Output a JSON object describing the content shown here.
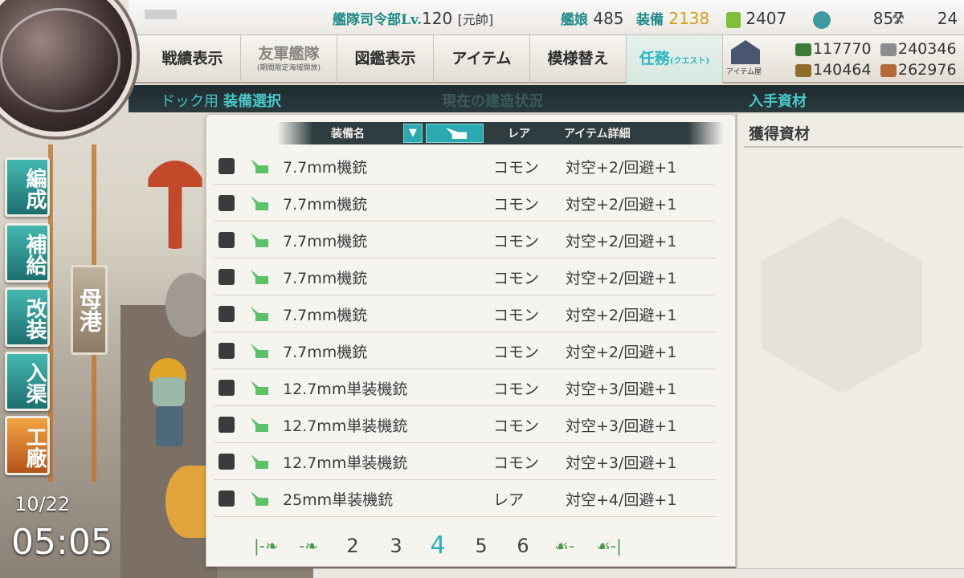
{
  "player": {
    "name_hidden": "",
    "hq_label": "艦隊司令部Lv.",
    "hq_level": "120",
    "rank": "[元帥]",
    "ships_label": "艦娘",
    "ships_count": "485",
    "equip_label": "装備",
    "equip_count": "2138"
  },
  "consumables": {
    "bucket": "2407",
    "devmat": "857",
    "screw": "24"
  },
  "resources": {
    "fuel": "117770",
    "steel": "240346",
    "ammo": "140464",
    "bauxite": "262976"
  },
  "menu": {
    "record": "戦績表示",
    "friend_fleet": "友軍艦隊",
    "friend_fleet_sub": "(期間限定海域開放)",
    "album": "図鑑表示",
    "items": "アイテム",
    "remodel": "模様替え",
    "quest": "任務",
    "quest_sub": "(クエスト)",
    "item_shop_label": "アイテム屋"
  },
  "section": {
    "dock": "ドック用",
    "equip_select": "装備選択",
    "build_status": "現在の建造状況",
    "obtain": "入手資材"
  },
  "side_nav": {
    "organize": "編成",
    "supply": "補給",
    "refit": "改装",
    "repair": "入渠",
    "arsenal": "工廠",
    "port": "母港"
  },
  "clock": {
    "date": "10/22",
    "time": "05:05"
  },
  "list": {
    "col_name": "装備名",
    "col_rarity": "レア",
    "col_detail": "アイテム詳細",
    "rows": [
      {
        "name": "7.7mm機銃",
        "rarity": "コモン",
        "detail": "対空+2/回避+1"
      },
      {
        "name": "7.7mm機銃",
        "rarity": "コモン",
        "detail": "対空+2/回避+1"
      },
      {
        "name": "7.7mm機銃",
        "rarity": "コモン",
        "detail": "対空+2/回避+1"
      },
      {
        "name": "7.7mm機銃",
        "rarity": "コモン",
        "detail": "対空+2/回避+1"
      },
      {
        "name": "7.7mm機銃",
        "rarity": "コモン",
        "detail": "対空+2/回避+1"
      },
      {
        "name": "7.7mm機銃",
        "rarity": "コモン",
        "detail": "対空+2/回避+1"
      },
      {
        "name": "12.7mm単装機銃",
        "rarity": "コモン",
        "detail": "対空+3/回避+1"
      },
      {
        "name": "12.7mm単装機銃",
        "rarity": "コモン",
        "detail": "対空+3/回避+1"
      },
      {
        "name": "12.7mm単装機銃",
        "rarity": "コモン",
        "detail": "対空+3/回避+1"
      },
      {
        "name": "25mm単装機銃",
        "rarity": "レア",
        "detail": "対空+4/回避+1"
      }
    ]
  },
  "pager": {
    "pages": [
      "2",
      "3",
      "4",
      "5",
      "6"
    ],
    "current": "4"
  },
  "materials": {
    "title": "獲得資材"
  },
  "colors": {
    "accent": "#2ab0b4",
    "gold": "#d39c15",
    "equip_icon": "#5cc26a"
  }
}
